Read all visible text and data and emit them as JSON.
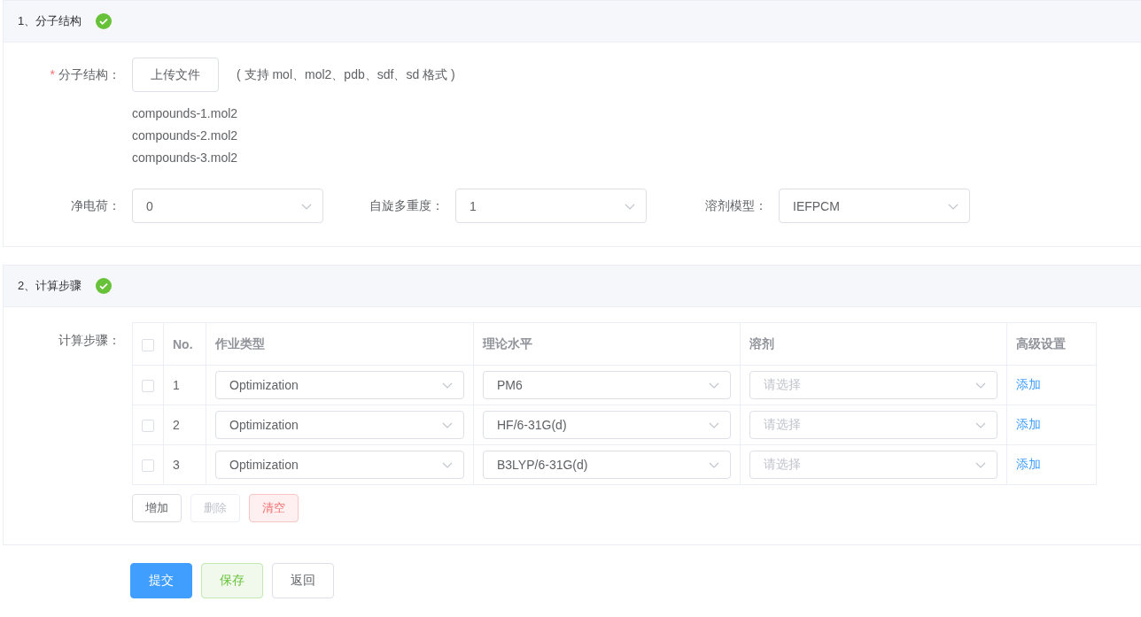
{
  "sections": [
    {
      "kind": "structure",
      "title": "1、分子结构",
      "complete": true,
      "upload": {
        "label": "分子结构：",
        "required": true,
        "required_mark": "*",
        "button": "上传文件",
        "hint": "( 支持 mol、mol2、pdb、sdf、sd 格式 )"
      },
      "files": [
        "compounds-1.mol2",
        "compounds-2.mol2",
        "compounds-3.mol2"
      ],
      "fields": [
        {
          "label": "净电荷：",
          "value": "0"
        },
        {
          "label": "自旋多重度：",
          "value": "1"
        },
        {
          "label": "溶剂模型：",
          "value": "IEFPCM"
        }
      ]
    },
    {
      "kind": "steps",
      "title": "2、计算步骤",
      "complete": true,
      "label": "计算步骤：",
      "table": {
        "all_checked": false,
        "columns": [
          "No.",
          "作业类型",
          "理论水平",
          "溶剂",
          "高级设置"
        ],
        "rows": [
          {
            "checked": false,
            "no": "1",
            "job": "Optimization",
            "level": "PM6",
            "solvent_placeholder": "请选择",
            "action": "添加"
          },
          {
            "checked": false,
            "no": "2",
            "job": "Optimization",
            "level": "HF/6-31G(d)",
            "solvent_placeholder": "请选择",
            "action": "添加"
          },
          {
            "checked": false,
            "no": "3",
            "job": "Optimization",
            "level": "B3LYP/6-31G(d)",
            "solvent_placeholder": "请选择",
            "action": "添加"
          }
        ]
      },
      "buttons": [
        {
          "kind": "default",
          "label": "增加",
          "disabled": false
        },
        {
          "kind": "default",
          "label": "删除",
          "disabled": true
        },
        {
          "kind": "danger",
          "label": "清空",
          "disabled": false
        }
      ]
    }
  ],
  "actions": [
    {
      "kind": "primary",
      "label": "提交"
    },
    {
      "kind": "success",
      "label": "保存"
    },
    {
      "kind": "default",
      "label": "返回"
    }
  ]
}
